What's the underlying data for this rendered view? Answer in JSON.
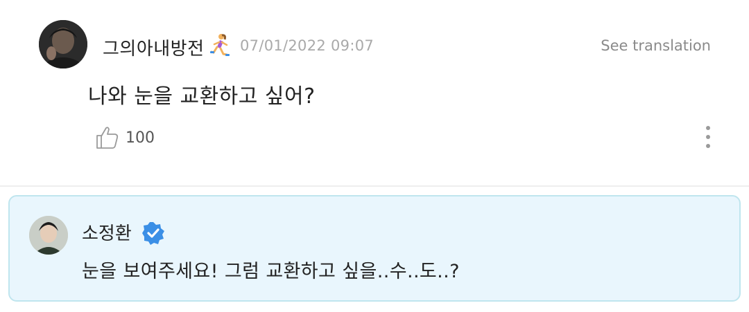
{
  "post": {
    "username": "그의아내방전",
    "emoji_icon": "woman-running-emoji",
    "timestamp": "07/01/2022 09:07",
    "see_translation": "See translation",
    "message": "나와 눈을 교환하고 싶어?",
    "like_count": "100",
    "avatar_icon": "user-avatar"
  },
  "reply": {
    "name": "소정환",
    "verified_icon": "verified-badge-icon",
    "text": "눈을 보여주세요! 그럼 교환하고 싶을..수..도..?",
    "accent_color": "#e9f6fd",
    "border_color": "#bfe5ee"
  },
  "colors": {
    "verified_badge": "#3b8fe6",
    "timestamp": "#a9a9a9"
  }
}
